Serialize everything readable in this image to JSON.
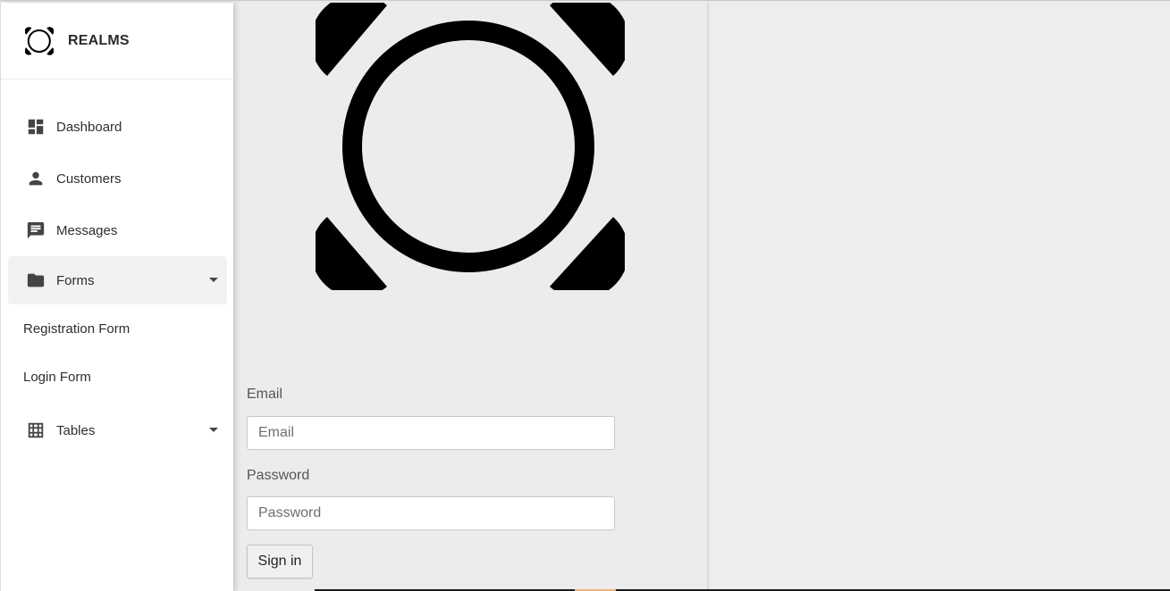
{
  "brand": {
    "name": "REALMS",
    "logo_icon": "realms-logo-icon"
  },
  "sidebar": {
    "items": [
      {
        "label": "Dashboard",
        "icon": "dashboard-icon"
      },
      {
        "label": "Customers",
        "icon": "person-icon"
      },
      {
        "label": "Messages",
        "icon": "message-icon"
      },
      {
        "label": "Forms",
        "icon": "folder-icon",
        "expanded": true
      },
      {
        "label": "Tables",
        "icon": "grid-icon",
        "expanded": false
      }
    ],
    "forms_subitems": [
      {
        "label": "Registration Form"
      },
      {
        "label": "Login Form"
      }
    ]
  },
  "login": {
    "logo_icon": "realms-logo-icon",
    "email_label": "Email",
    "email_placeholder": "Email",
    "email_value": "",
    "password_label": "Password",
    "password_placeholder": "Password",
    "password_value": "",
    "signin_label": "Sign in"
  },
  "colors": {
    "sidebar_bg": "#ffffff",
    "content_bg": "#ececec",
    "active_item_bg": "#f2f2f2",
    "text": "#2e2e2e",
    "icon": "#444444"
  }
}
